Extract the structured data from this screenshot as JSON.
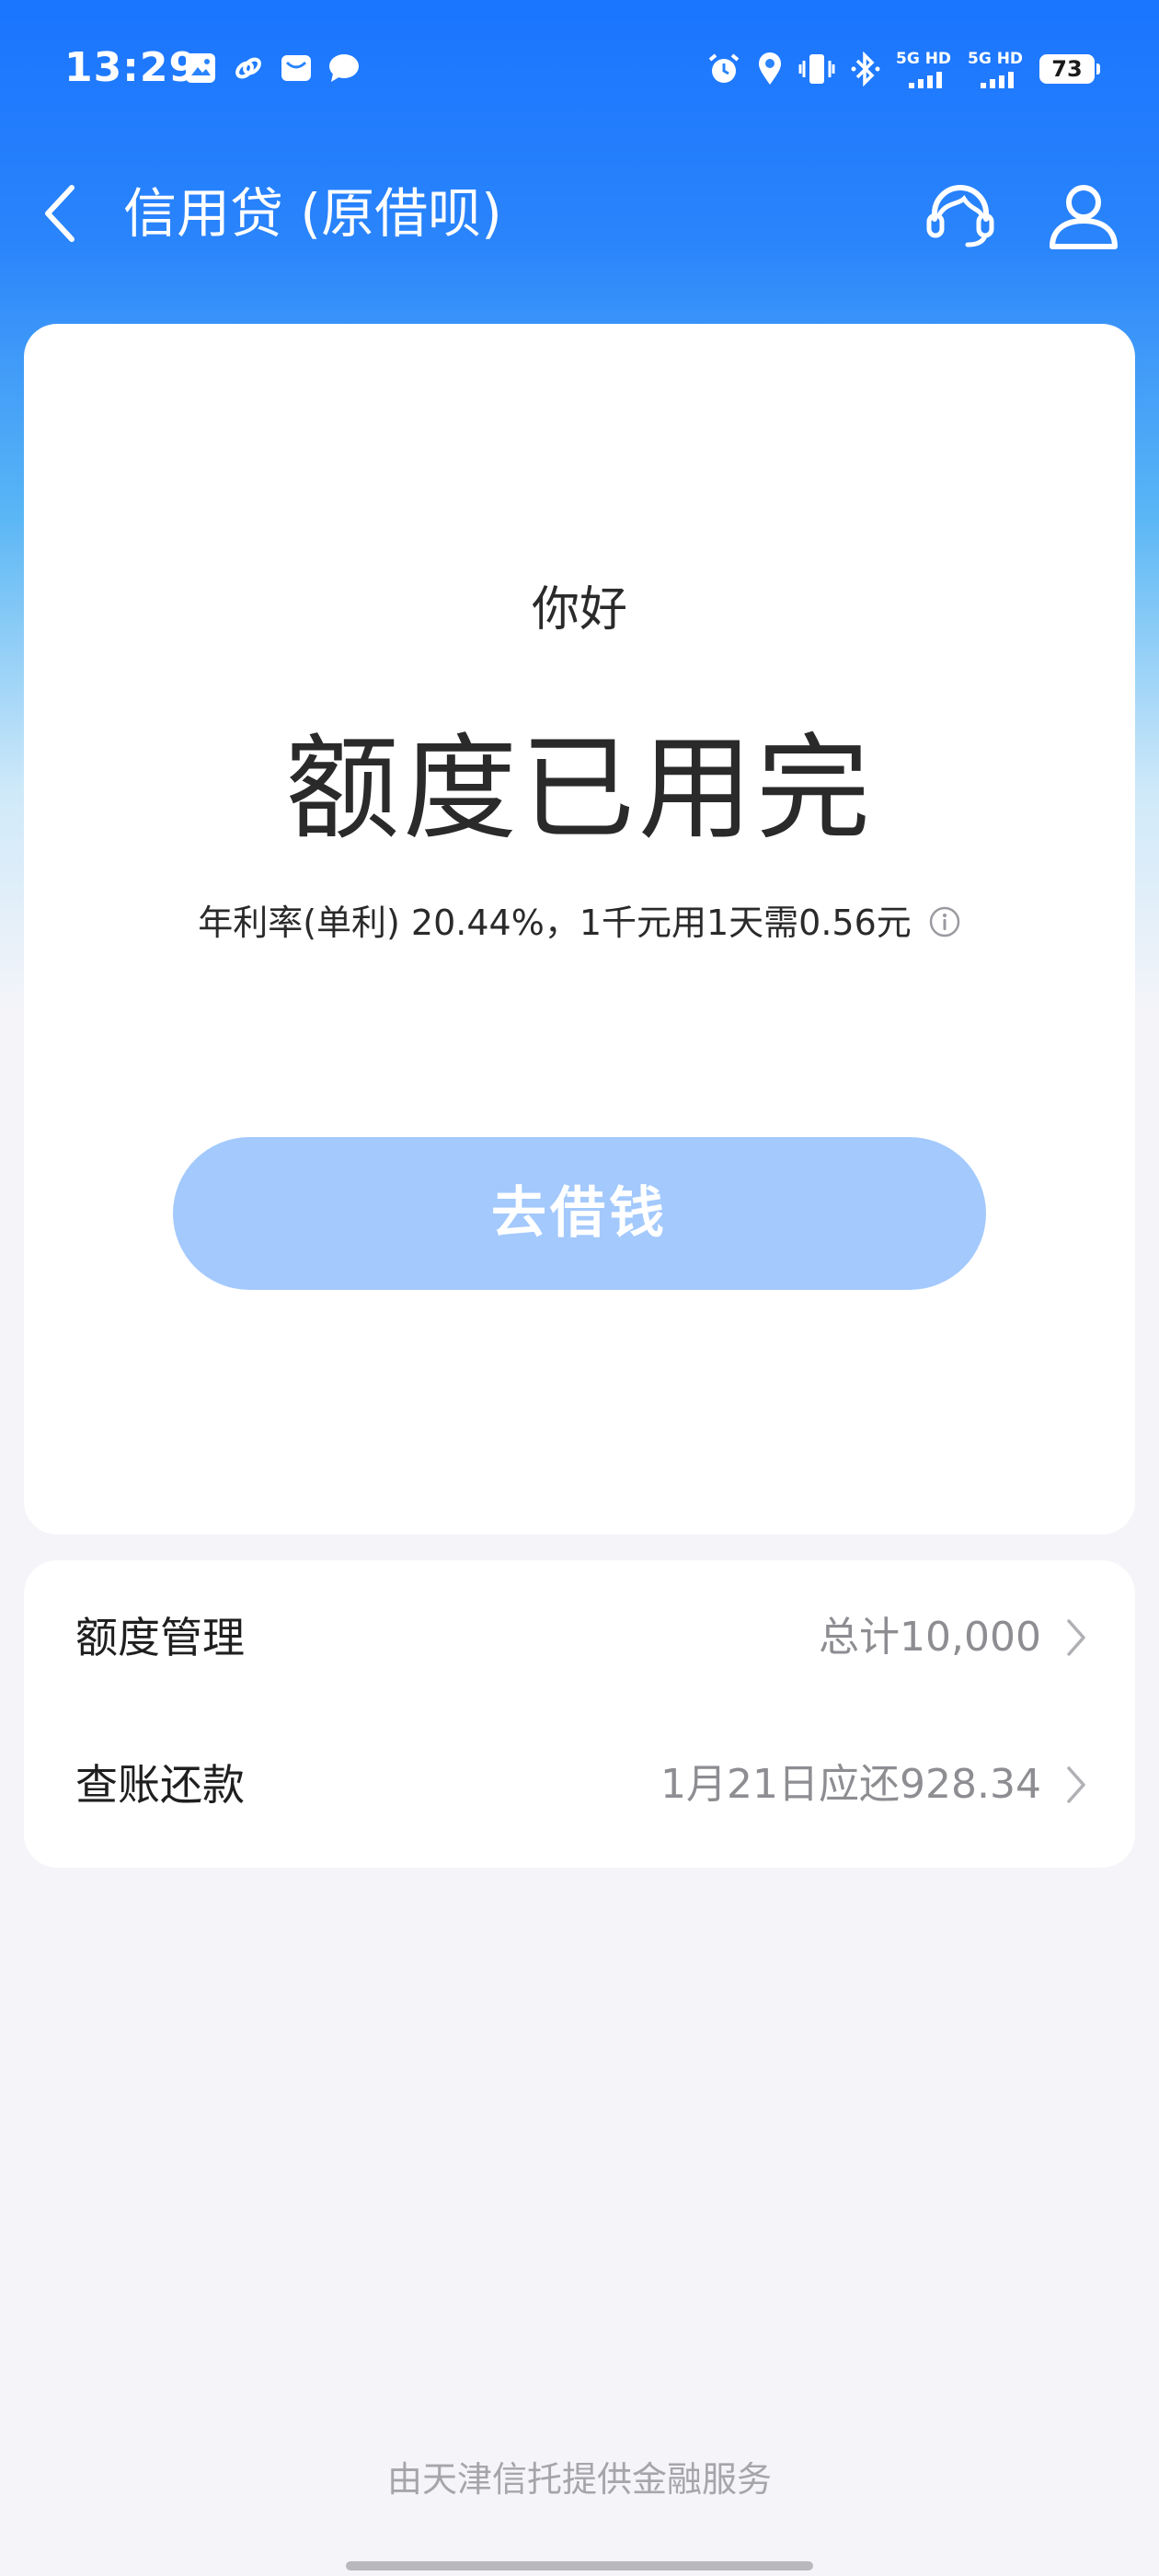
{
  "status_bar": {
    "time": "13:29",
    "notification_icons": [
      "image-icon",
      "link-icon",
      "mail-icon",
      "chat-bubble-icon"
    ],
    "status_icons": [
      "alarm-icon",
      "location-icon",
      "vibrate-icon",
      "bluetooth-icon"
    ],
    "signal_1_label": "5G HD",
    "signal_2_label": "5G HD",
    "battery": "73"
  },
  "nav": {
    "title": "信用贷 (原借呗)"
  },
  "main_card": {
    "greeting": "你好",
    "headline": "额度已用完",
    "rate_text": "年利率(单利) 20.44%，1千元用1天需0.56元",
    "borrow_button": "去借钱"
  },
  "menu": {
    "items": [
      {
        "label": "额度管理",
        "value": "总计10,000"
      },
      {
        "label": "查账还款",
        "value": "1月21日应还928.34"
      }
    ]
  },
  "footer": {
    "text": "由天津信托提供金融服务"
  },
  "colors": {
    "brand_blue": "#1a75ff",
    "button_disabled": "#a3c9fd",
    "page_background": "#f4f4f9",
    "secondary_text": "#8d8d92"
  }
}
